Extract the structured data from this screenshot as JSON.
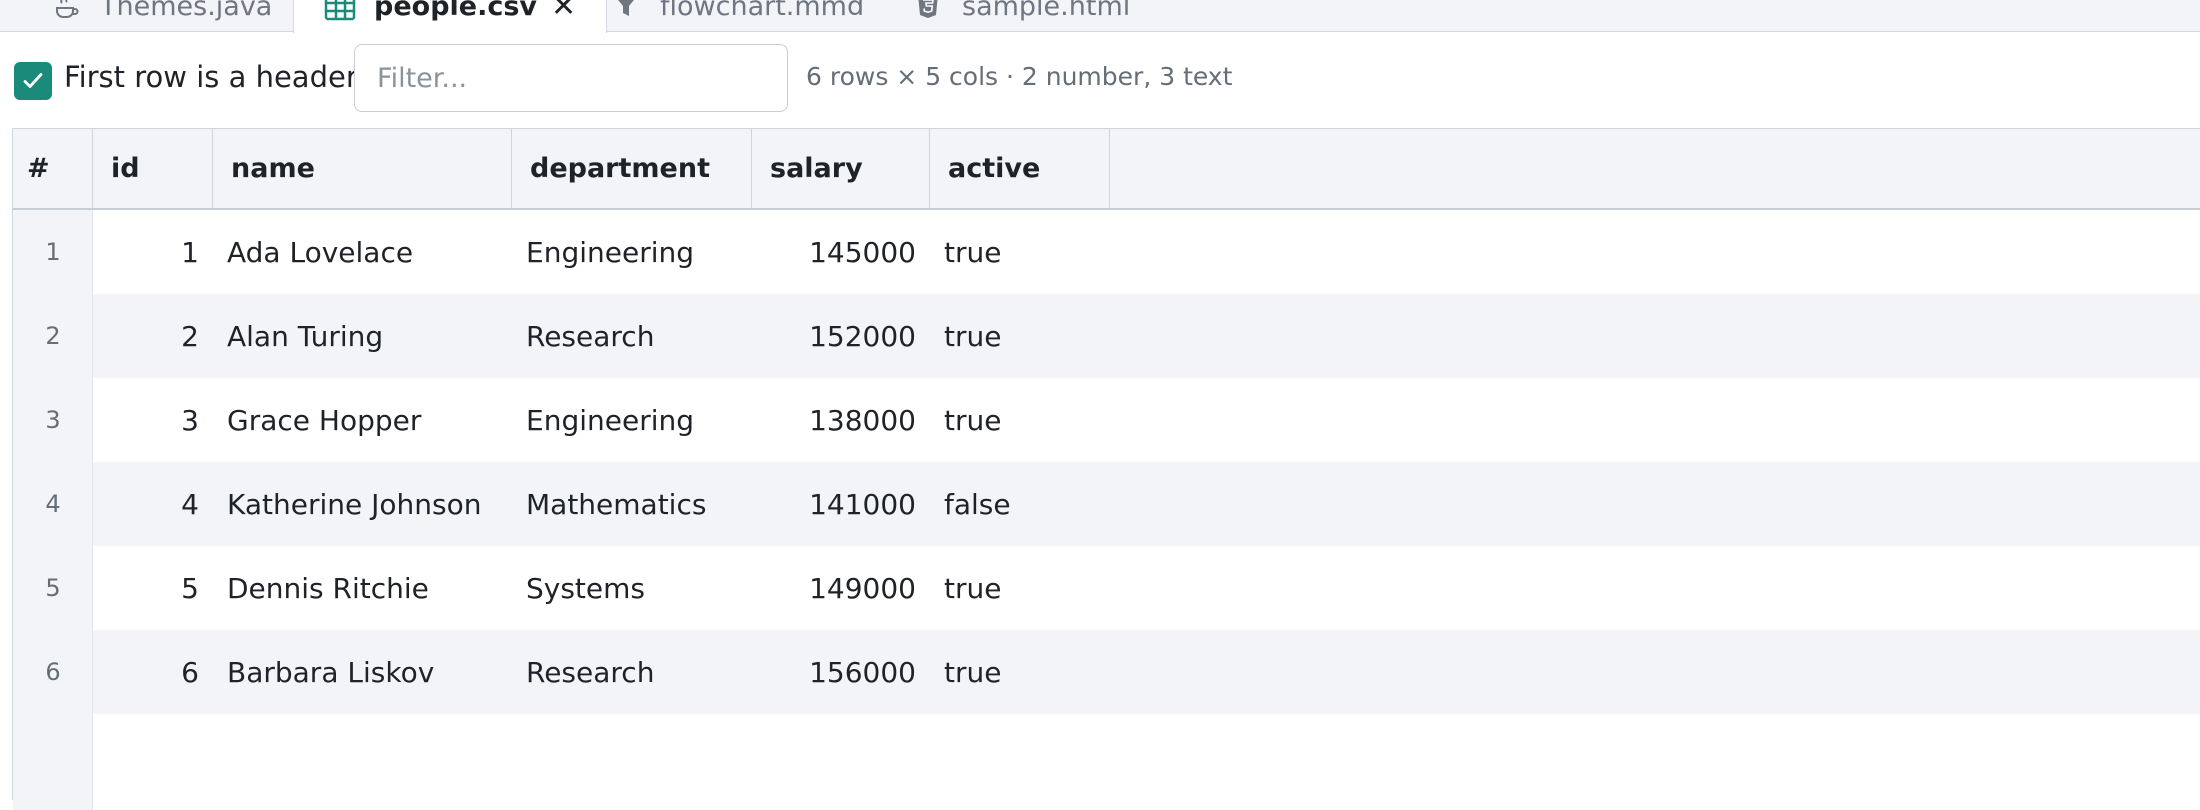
{
  "tabs": [
    {
      "label": "Themes.java",
      "icon": "java-icon",
      "active": false
    },
    {
      "label": "people.csv",
      "icon": "table-icon",
      "active": true
    },
    {
      "label": "flowchart.mmd",
      "icon": "funnel-icon",
      "active": false
    },
    {
      "label": "sample.html",
      "icon": "html5-icon",
      "active": false
    }
  ],
  "toolbar": {
    "header_checkbox_checked": true,
    "header_checkbox_label": "First row is a header",
    "filter_placeholder": "Filter...",
    "filter_value": "",
    "summary": "6 rows × 5 cols · 2 number, 3 text"
  },
  "table": {
    "columns": [
      "#",
      "id",
      "name",
      "department",
      "salary",
      "active"
    ],
    "rows": [
      {
        "n": "1",
        "id": "1",
        "name": "Ada Lovelace",
        "department": "Engineering",
        "salary": "145000",
        "active": "true"
      },
      {
        "n": "2",
        "id": "2",
        "name": "Alan Turing",
        "department": "Research",
        "salary": "152000",
        "active": "true"
      },
      {
        "n": "3",
        "id": "3",
        "name": "Grace Hopper",
        "department": "Engineering",
        "salary": "138000",
        "active": "true"
      },
      {
        "n": "4",
        "id": "4",
        "name": "Katherine Johnson",
        "department": "Mathematics",
        "salary": "141000",
        "active": "false"
      },
      {
        "n": "5",
        "id": "5",
        "name": "Dennis Ritchie",
        "department": "Systems",
        "salary": "149000",
        "active": "true"
      },
      {
        "n": "6",
        "id": "6",
        "name": "Barbara Liskov",
        "department": "Research",
        "salary": "156000",
        "active": "true"
      }
    ]
  },
  "colors": {
    "accent": "#1a8a7a",
    "header_bg": "#f3f4f8",
    "stripe_bg": "#f3f4f8"
  }
}
